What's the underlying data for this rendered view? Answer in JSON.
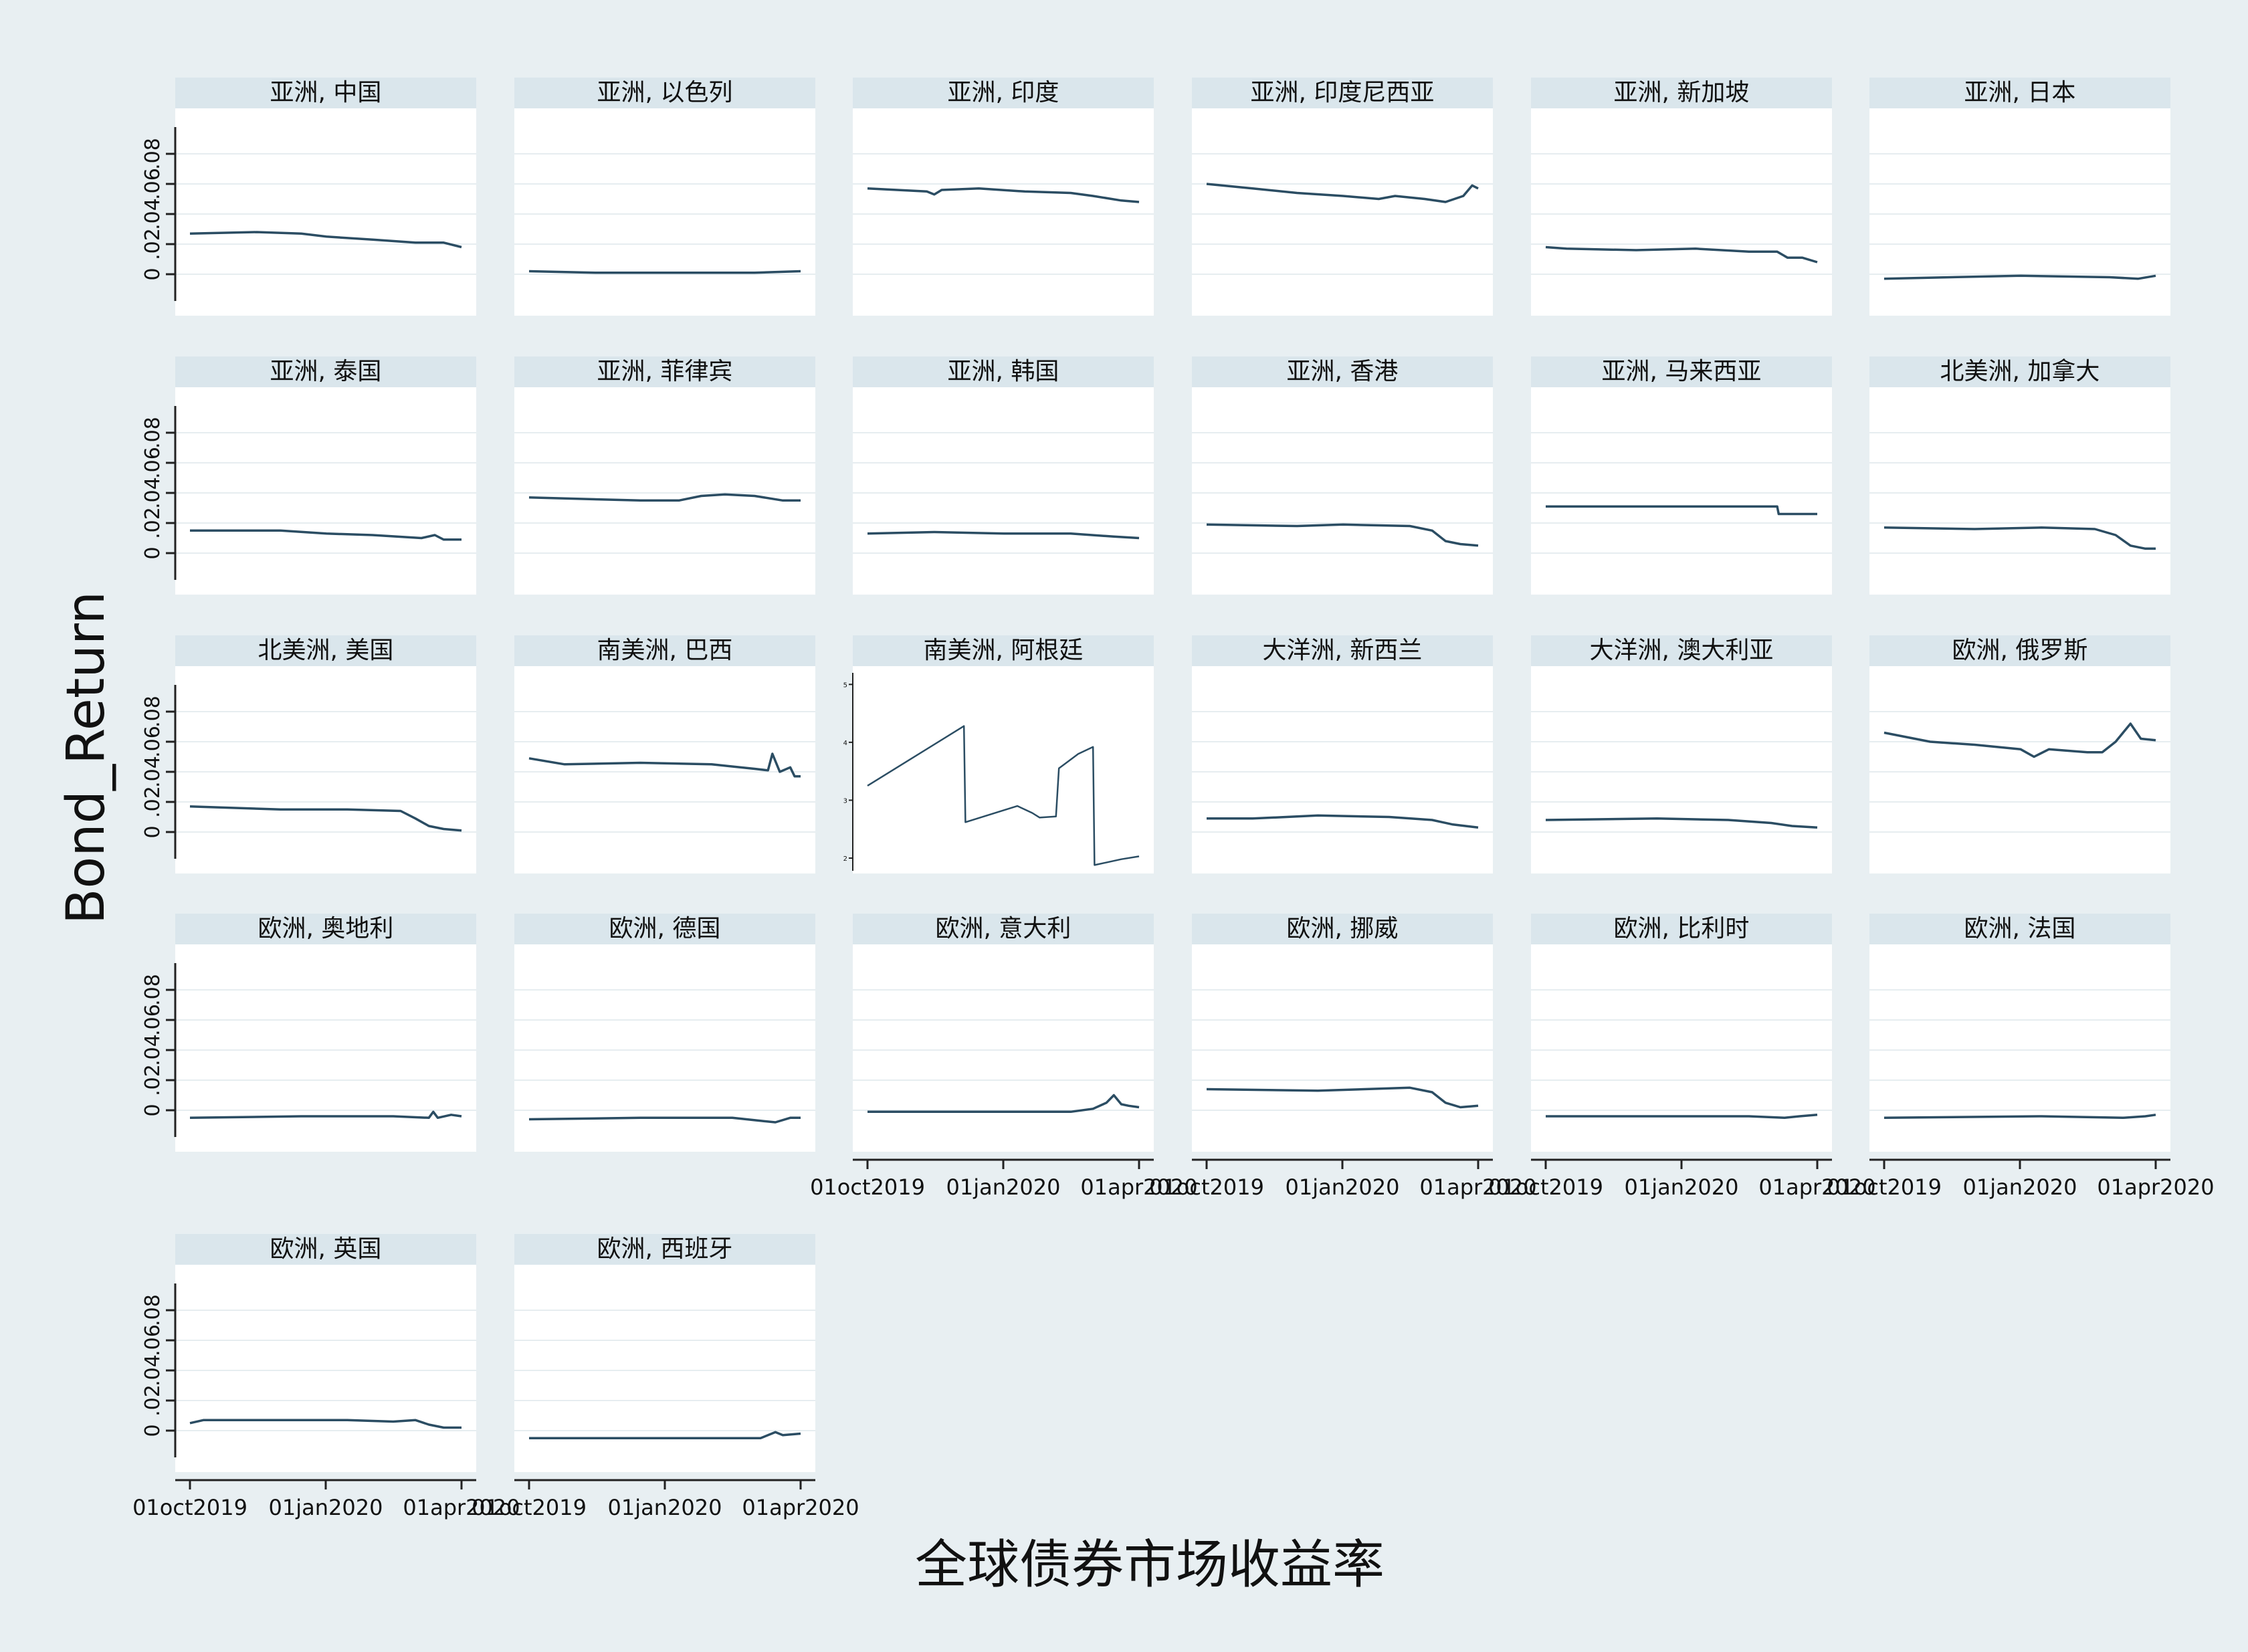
{
  "chart_data": {
    "type": "line",
    "title": "全球债券市场收益率",
    "ylabel": "Bond_Return",
    "y_ticks": [
      "0",
      ".02",
      ".04",
      ".06",
      ".08"
    ],
    "ylim": [
      -0.012,
      0.088
    ],
    "x_ticks": [
      "01oct2019",
      "01jan2020",
      "01apr2020"
    ],
    "xlim": [
      "2019-10-01",
      "2020-04-01"
    ],
    "grid": true,
    "colors": {
      "background": "#e8eff2",
      "plot_background": "#ffffff",
      "strip_background": "#dae6ec",
      "line": "#2b4d63",
      "gridline": "#e6edf0",
      "axis": "#222222",
      "text": "#111111"
    },
    "panels": [
      {
        "title": "亚洲, 中国",
        "points": [
          [
            "2019-10-01",
            0.027
          ],
          [
            "2019-11-15",
            0.028
          ],
          [
            "2019-12-15",
            0.027
          ],
          [
            "2020-01-01",
            0.025
          ],
          [
            "2020-02-01",
            0.023
          ],
          [
            "2020-03-01",
            0.021
          ],
          [
            "2020-03-20",
            0.021
          ],
          [
            "2020-04-01",
            0.018
          ]
        ]
      },
      {
        "title": "亚洲, 以色列",
        "points": [
          [
            "2019-10-01",
            0.002
          ],
          [
            "2019-11-15",
            0.001
          ],
          [
            "2020-01-01",
            0.001
          ],
          [
            "2020-03-01",
            0.001
          ],
          [
            "2020-04-01",
            0.002
          ]
        ]
      },
      {
        "title": "亚洲, 印度",
        "points": [
          [
            "2019-10-01",
            0.057
          ],
          [
            "2019-11-10",
            0.055
          ],
          [
            "2019-11-15",
            0.053
          ],
          [
            "2019-11-20",
            0.056
          ],
          [
            "2019-12-15",
            0.057
          ],
          [
            "2020-01-15",
            0.055
          ],
          [
            "2020-02-15",
            0.054
          ],
          [
            "2020-03-01",
            0.052
          ],
          [
            "2020-03-20",
            0.049
          ],
          [
            "2020-04-01",
            0.048
          ]
        ]
      },
      {
        "title": "亚洲, 印度尼西亚",
        "points": [
          [
            "2019-10-01",
            0.06
          ],
          [
            "2019-11-01",
            0.057
          ],
          [
            "2019-12-01",
            0.054
          ],
          [
            "2020-01-01",
            0.052
          ],
          [
            "2020-01-25",
            0.05
          ],
          [
            "2020-02-05",
            0.052
          ],
          [
            "2020-02-25",
            0.05
          ],
          [
            "2020-03-10",
            0.048
          ],
          [
            "2020-03-22",
            0.052
          ],
          [
            "2020-03-28",
            0.059
          ],
          [
            "2020-04-01",
            0.057
          ]
        ]
      },
      {
        "title": "亚洲, 新加坡",
        "points": [
          [
            "2019-10-01",
            0.018
          ],
          [
            "2019-10-15",
            0.017
          ],
          [
            "2019-12-01",
            0.016
          ],
          [
            "2020-01-10",
            0.017
          ],
          [
            "2020-02-15",
            0.015
          ],
          [
            "2020-03-05",
            0.015
          ],
          [
            "2020-03-12",
            0.011
          ],
          [
            "2020-03-22",
            0.011
          ],
          [
            "2020-04-01",
            0.008
          ]
        ]
      },
      {
        "title": "亚洲, 日本",
        "points": [
          [
            "2019-10-01",
            -0.003
          ],
          [
            "2019-11-15",
            -0.002
          ],
          [
            "2020-01-01",
            -0.001
          ],
          [
            "2020-03-01",
            -0.002
          ],
          [
            "2020-03-20",
            -0.003
          ],
          [
            "2020-04-01",
            -0.001
          ]
        ]
      },
      {
        "title": "亚洲, 泰国",
        "points": [
          [
            "2019-10-01",
            0.015
          ],
          [
            "2019-12-01",
            0.015
          ],
          [
            "2020-01-01",
            0.013
          ],
          [
            "2020-02-01",
            0.012
          ],
          [
            "2020-03-05",
            0.01
          ],
          [
            "2020-03-14",
            0.012
          ],
          [
            "2020-03-20",
            0.009
          ],
          [
            "2020-04-01",
            0.009
          ]
        ]
      },
      {
        "title": "亚洲, 菲律宾",
        "points": [
          [
            "2019-10-01",
            0.037
          ],
          [
            "2019-12-15",
            0.035
          ],
          [
            "2020-01-10",
            0.035
          ],
          [
            "2020-01-25",
            0.038
          ],
          [
            "2020-02-10",
            0.039
          ],
          [
            "2020-03-01",
            0.038
          ],
          [
            "2020-03-20",
            0.035
          ],
          [
            "2020-04-01",
            0.035
          ]
        ]
      },
      {
        "title": "亚洲, 韩国",
        "points": [
          [
            "2019-10-01",
            0.013
          ],
          [
            "2019-11-15",
            0.014
          ],
          [
            "2020-01-01",
            0.013
          ],
          [
            "2020-02-15",
            0.013
          ],
          [
            "2020-03-15",
            0.011
          ],
          [
            "2020-04-01",
            0.01
          ]
        ]
      },
      {
        "title": "亚洲, 香港",
        "points": [
          [
            "2019-10-01",
            0.019
          ],
          [
            "2019-12-01",
            0.018
          ],
          [
            "2020-01-01",
            0.019
          ],
          [
            "2020-02-15",
            0.018
          ],
          [
            "2020-03-01",
            0.015
          ],
          [
            "2020-03-10",
            0.008
          ],
          [
            "2020-03-20",
            0.006
          ],
          [
            "2020-04-01",
            0.005
          ]
        ]
      },
      {
        "title": "亚洲, 马来西亚",
        "points": [
          [
            "2019-10-01",
            0.031
          ],
          [
            "2020-03-05",
            0.031
          ],
          [
            "2020-03-06",
            0.026
          ],
          [
            "2020-04-01",
            0.026
          ]
        ]
      },
      {
        "title": "北美洲, 加拿大",
        "points": [
          [
            "2019-10-01",
            0.017
          ],
          [
            "2019-12-01",
            0.016
          ],
          [
            "2020-01-15",
            0.017
          ],
          [
            "2020-02-20",
            0.016
          ],
          [
            "2020-03-05",
            0.012
          ],
          [
            "2020-03-15",
            0.005
          ],
          [
            "2020-03-25",
            0.003
          ],
          [
            "2020-04-01",
            0.003
          ]
        ]
      },
      {
        "title": "北美洲, 美国",
        "points": [
          [
            "2019-10-01",
            0.017
          ],
          [
            "2019-12-01",
            0.015
          ],
          [
            "2020-01-15",
            0.015
          ],
          [
            "2020-02-20",
            0.014
          ],
          [
            "2020-03-01",
            0.009
          ],
          [
            "2020-03-10",
            0.004
          ],
          [
            "2020-03-20",
            0.002
          ],
          [
            "2020-04-01",
            0.001
          ]
        ]
      },
      {
        "title": "南美洲, 巴西",
        "points": [
          [
            "2019-10-01",
            0.049
          ],
          [
            "2019-10-25",
            0.045
          ],
          [
            "2019-12-15",
            0.046
          ],
          [
            "2020-02-01",
            0.045
          ],
          [
            "2020-03-01",
            0.042
          ],
          [
            "2020-03-10",
            0.041
          ],
          [
            "2020-03-13",
            0.052
          ],
          [
            "2020-03-18",
            0.04
          ],
          [
            "2020-03-25",
            0.043
          ],
          [
            "2020-03-28",
            0.037
          ],
          [
            "2020-04-01",
            0.037
          ]
        ]
      },
      {
        "title": "南美洲, 阿根廷",
        "own_axis": true,
        "y_ticks": [
          "2",
          "3",
          "4",
          "5"
        ],
        "ylim": [
          1.85,
          5.2
        ],
        "points": [
          [
            "2019-10-01",
            3.25
          ],
          [
            "2019-12-05",
            4.28
          ],
          [
            "2019-12-06",
            2.62
          ],
          [
            "2020-01-10",
            2.9
          ],
          [
            "2020-01-20",
            2.78
          ],
          [
            "2020-01-25",
            2.7
          ],
          [
            "2020-02-05",
            2.72
          ],
          [
            "2020-02-07",
            3.55
          ],
          [
            "2020-02-20",
            3.8
          ],
          [
            "2020-03-01",
            3.92
          ],
          [
            "2020-03-02",
            1.88
          ],
          [
            "2020-03-20",
            1.98
          ],
          [
            "2020-04-01",
            2.03
          ]
        ]
      },
      {
        "title": "大洋洲, 新西兰",
        "points": [
          [
            "2019-10-01",
            0.009
          ],
          [
            "2019-11-01",
            0.009
          ],
          [
            "2019-12-15",
            0.011
          ],
          [
            "2020-02-01",
            0.01
          ],
          [
            "2020-03-01",
            0.008
          ],
          [
            "2020-03-15",
            0.005
          ],
          [
            "2020-04-01",
            0.003
          ]
        ]
      },
      {
        "title": "大洋洲, 澳大利亚",
        "points": [
          [
            "2019-10-01",
            0.008
          ],
          [
            "2019-12-15",
            0.009
          ],
          [
            "2020-02-01",
            0.008
          ],
          [
            "2020-03-01",
            0.006
          ],
          [
            "2020-03-15",
            0.004
          ],
          [
            "2020-04-01",
            0.003
          ]
        ]
      },
      {
        "title": "欧洲, 俄罗斯",
        "points": [
          [
            "2019-10-01",
            0.066
          ],
          [
            "2019-11-01",
            0.06
          ],
          [
            "2019-12-01",
            0.058
          ],
          [
            "2020-01-01",
            0.055
          ],
          [
            "2020-01-10",
            0.05
          ],
          [
            "2020-01-20",
            0.055
          ],
          [
            "2020-02-15",
            0.053
          ],
          [
            "2020-02-25",
            0.053
          ],
          [
            "2020-03-05",
            0.06
          ],
          [
            "2020-03-15",
            0.072
          ],
          [
            "2020-03-22",
            0.062
          ],
          [
            "2020-04-01",
            0.061
          ]
        ]
      },
      {
        "title": "欧洲, 奥地利",
        "points": [
          [
            "2019-10-01",
            -0.005
          ],
          [
            "2019-12-15",
            -0.004
          ],
          [
            "2020-02-15",
            -0.004
          ],
          [
            "2020-03-10",
            -0.005
          ],
          [
            "2020-03-13",
            -0.001
          ],
          [
            "2020-03-16",
            -0.005
          ],
          [
            "2020-03-25",
            -0.003
          ],
          [
            "2020-04-01",
            -0.004
          ]
        ]
      },
      {
        "title": "欧洲, 德国",
        "points": [
          [
            "2019-10-01",
            -0.006
          ],
          [
            "2019-12-15",
            -0.005
          ],
          [
            "2020-02-15",
            -0.005
          ],
          [
            "2020-03-05",
            -0.007
          ],
          [
            "2020-03-15",
            -0.008
          ],
          [
            "2020-03-25",
            -0.005
          ],
          [
            "2020-04-01",
            -0.005
          ]
        ]
      },
      {
        "title": "欧洲, 意大利",
        "points": [
          [
            "2019-10-01",
            -0.001
          ],
          [
            "2019-11-15",
            -0.001
          ],
          [
            "2020-01-01",
            -0.001
          ],
          [
            "2020-02-15",
            -0.001
          ],
          [
            "2020-03-01",
            0.001
          ],
          [
            "2020-03-10",
            0.005
          ],
          [
            "2020-03-15",
            0.01
          ],
          [
            "2020-03-20",
            0.004
          ],
          [
            "2020-03-25",
            0.003
          ],
          [
            "2020-04-01",
            0.002
          ]
        ]
      },
      {
        "title": "欧洲, 挪威",
        "points": [
          [
            "2019-10-01",
            0.014
          ],
          [
            "2019-12-15",
            0.013
          ],
          [
            "2020-02-15",
            0.015
          ],
          [
            "2020-03-01",
            0.012
          ],
          [
            "2020-03-10",
            0.005
          ],
          [
            "2020-03-20",
            0.002
          ],
          [
            "2020-04-01",
            0.003
          ]
        ]
      },
      {
        "title": "欧洲, 比利时",
        "points": [
          [
            "2019-10-01",
            -0.004
          ],
          [
            "2020-02-15",
            -0.004
          ],
          [
            "2020-03-10",
            -0.005
          ],
          [
            "2020-03-20",
            -0.004
          ],
          [
            "2020-04-01",
            -0.003
          ]
        ]
      },
      {
        "title": "欧洲, 法国",
        "points": [
          [
            "2019-10-01",
            -0.005
          ],
          [
            "2020-01-15",
            -0.004
          ],
          [
            "2020-03-10",
            -0.005
          ],
          [
            "2020-03-25",
            -0.004
          ],
          [
            "2020-04-01",
            -0.003
          ]
        ]
      },
      {
        "title": "欧洲, 英国",
        "points": [
          [
            "2019-10-01",
            0.005
          ],
          [
            "2019-10-10",
            0.007
          ],
          [
            "2020-01-15",
            0.007
          ],
          [
            "2020-02-15",
            0.006
          ],
          [
            "2020-03-01",
            0.007
          ],
          [
            "2020-03-10",
            0.004
          ],
          [
            "2020-03-20",
            0.002
          ],
          [
            "2020-04-01",
            0.002
          ]
        ]
      },
      {
        "title": "欧洲, 西班牙",
        "points": [
          [
            "2019-10-01",
            -0.005
          ],
          [
            "2020-01-15",
            -0.005
          ],
          [
            "2020-03-05",
            -0.005
          ],
          [
            "2020-03-15",
            -0.001
          ],
          [
            "2020-03-20",
            -0.003
          ],
          [
            "2020-04-01",
            -0.002
          ]
        ]
      }
    ]
  }
}
